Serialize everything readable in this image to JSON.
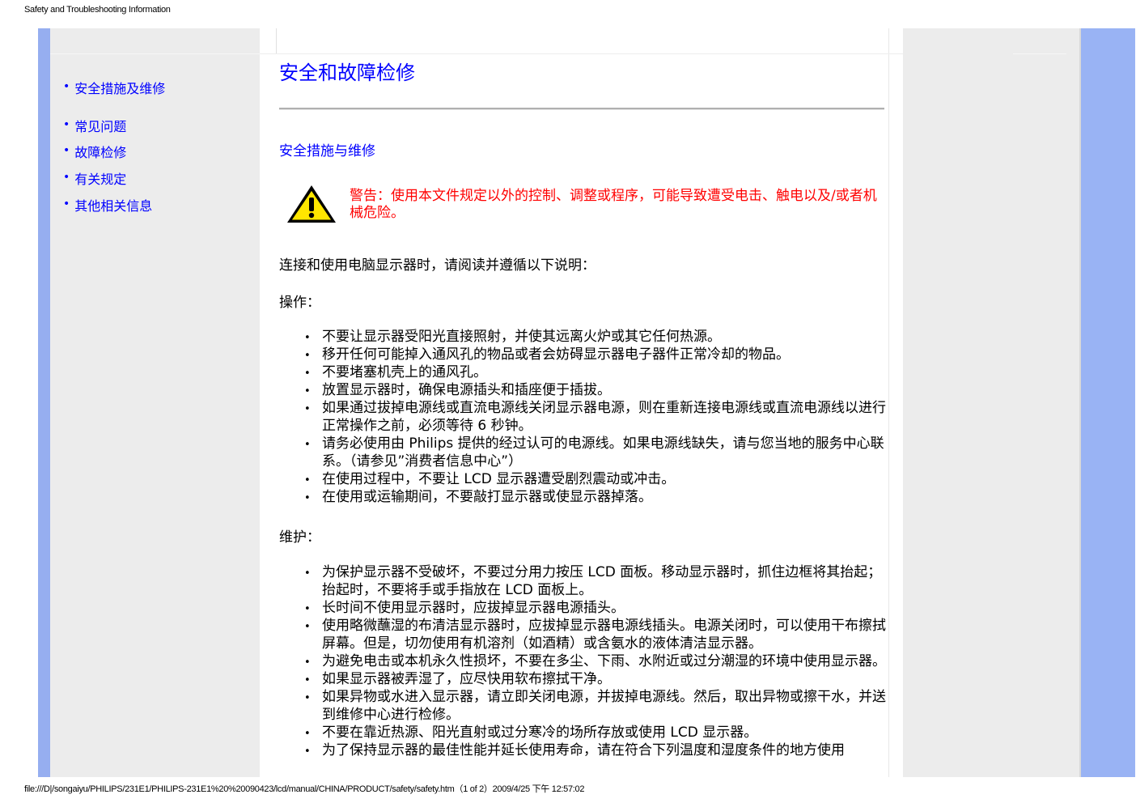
{
  "page_header": "Safety and Troubleshooting Information",
  "page_footer": "file:///D|/songaiyu/PHILIPS/231E1/PHILIPS-231E1%20%20090423/lcd/manual/CHINA/PRODUCT/safety/safety.htm（1 of 2）2009/4/25 下午 12:57:02",
  "sidebar": {
    "items": [
      {
        "label": "安全措施及维修"
      },
      {
        "label": "常见问题"
      },
      {
        "label": "故障检修"
      },
      {
        "label": "有关规定"
      },
      {
        "label": "其他相关信息"
      }
    ]
  },
  "main": {
    "title": "安全和故障检修",
    "subtitle": "安全措施与维修",
    "warning": "警告：使用本文件规定以外的控制、调整或程序，可能导致遭受电击、触电以及/或者机械危险。",
    "intro": "连接和使用电脑显示器时，请阅读并遵循以下说明：",
    "operation_heading": "操作：",
    "operation_items": [
      "不要让显示器受阳光直接照射，并使其远离火炉或其它任何热源。",
      "移开任何可能掉入通风孔的物品或者会妨碍显示器电子器件正常冷却的物品。",
      "不要堵塞机壳上的通风孔。",
      "放置显示器时，确保电源插头和插座便于插拔。",
      "如果通过拔掉电源线或直流电源线关闭显示器电源，则在重新连接电源线或直流电源线以进行正常操作之前，必须等待 6 秒钟。",
      "请务必使用由 Philips 提供的经过认可的电源线。如果电源线缺失，请与您当地的服务中心联系。（请参见”消费者信息中心”）",
      "在使用过程中，不要让 LCD 显示器遭受剧烈震动或冲击。",
      "在使用或运输期间，不要敲打显示器或使显示器掉落。"
    ],
    "maintenance_heading": "维护：",
    "maintenance_items": [
      "为保护显示器不受破坏，不要过分用力按压 LCD 面板。移动显示器时，抓住边框将其抬起；抬起时，不要将手或手指放在 LCD 面板上。",
      "长时间不使用显示器时，应拔掉显示器电源插头。",
      "使用略微蘸湿的布清洁显示器时，应拔掉显示器电源线插头。电源关闭时，可以使用干布擦拭屏幕。但是，切勿使用有机溶剂（如酒精）或含氨水的液体清洁显示器。",
      "为避免电击或本机永久性损坏，不要在多尘、下雨、水附近或过分潮湿的环境中使用显示器。",
      "如果显示器被弄湿了，应尽快用软布擦拭干净。",
      "如果异物或水进入显示器，请立即关闭电源，并拔掉电源线。然后，取出异物或擦干水，并送到维修中心进行检修。",
      "不要在靠近热源、阳光直射或过分寒冷的场所存放或使用 LCD 显示器。",
      "为了保持显示器的最佳性能并延长使用寿命，请在符合下列温度和湿度条件的地方使用"
    ]
  }
}
